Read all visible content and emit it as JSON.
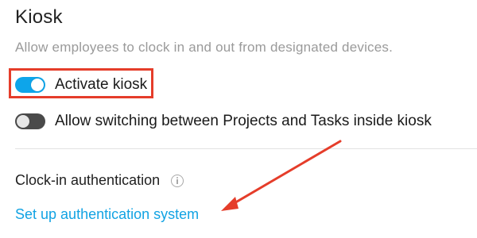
{
  "section": {
    "title": "Kiosk",
    "subtitle": "Allow employees to clock in and out from designated devices."
  },
  "toggles": [
    {
      "label": "Activate kiosk",
      "state": "on"
    },
    {
      "label": "Allow switching between Projects and Tasks inside kiosk",
      "state": "off"
    }
  ],
  "auth": {
    "label": "Clock-in authentication",
    "info_icon": "info-icon",
    "link_text": "Set up authentication system"
  },
  "annotations": {
    "highlight_color": "#e53d2a",
    "arrow_color": "#e53d2a"
  },
  "colors": {
    "toggle_on": "#0ea5ea",
    "toggle_off": "#4a4a4a",
    "link": "#12a3e3",
    "subtitle": "#9a9a9a"
  }
}
